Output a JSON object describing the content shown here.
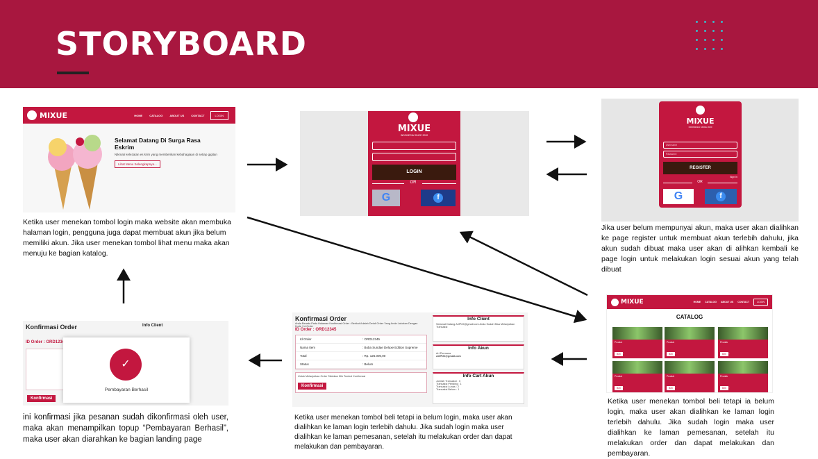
{
  "title": "STORYBOARD",
  "brand": "MIXUE",
  "brand_sub": "INDONESIA SINCE 2020",
  "nav": {
    "home": "HOME",
    "catalog": "CATALOG",
    "about": "ABOUT US",
    "contact": "CONTACT",
    "login": "LOGIN"
  },
  "landing": {
    "heading_1": "Selamat Datang Di Surga Rasa",
    "heading_2": "Eskrim",
    "body": "Nikmati kelezatan es krim yang memberikan kebahagiaan di setiap gigitan",
    "button": "Lihat Menu Selengkapnya...",
    "desc": "Ketika user  menekan tombol login maka website akan membuka halaman login, pengguna juga dapat membuat akun jika belum memiliki akun. Jika user menekan tombol lihat menu maka akan menuju ke bagian katalog."
  },
  "login": {
    "button": "LOGIN",
    "or": "OR",
    "google": "G",
    "facebook": "f"
  },
  "register": {
    "username_placeholder": "Username",
    "password_placeholder": "Password",
    "button": "REGISTER",
    "signin": "Sign In",
    "or": "OR",
    "desc": "Jika user belum mempunyai akun, maka user akan dialihkan ke page register untuk membuat akun terlebih dahulu, jika akun sudah dibuat maka user akan di alihkan kembali ke page login untuk melakukan login sesuai akun yang telah dibuat"
  },
  "catalog": {
    "title": "CATALOG",
    "item_label": "Produk",
    "item_price": "Rp. ........",
    "buy": "Beli",
    "desc": "Ketika user  menekan tombol beli tetapi ia belum login, maka user akan dialihkan ke laman login terlebih dahulu. Jika sudah login maka user dialihkan ke laman pemesanan, setelah itu melakukan order dan dapat melakukan dan pembayaran."
  },
  "order": {
    "title": "Konfirmasi Order",
    "subtitle": "Anda Berada Pada Halaman Konfirmasi Order : Berikut Adalah Detail Order Yang Anda Lakukan Dengan Kode / Id Order",
    "id_line": "ID Order : ORD12345",
    "rows": [
      {
        "k": "Id Order",
        "v": ": ORD12345"
      },
      {
        "k": "Nama Item",
        "v": ": Boba Sundae Deluxe Edition Supreme"
      },
      {
        "k": "Total",
        "v": ": Rp. 125.000,00"
      },
      {
        "k": "Status",
        "v": ": Belum"
      }
    ],
    "note": "Untuk Melanjutkan Order Silahkan Klik Tombol Konfirmasi",
    "confirm": "Konfirmasi",
    "info_client": "Info Client",
    "client_text": "Selamat Datang ArifP22@gmail.com Anda Sudah Bisa Melanjutkan Transaksi",
    "info_akun": "Info Akun",
    "akun_name": "Ari Permana",
    "akun_email": "ArifP22@gmail.com",
    "info_cart": "Info Cart Akun",
    "cart_lines": [
      "Jumlah Transaksi : 3",
      "Transaksi Pending : 1",
      "Transaksi Lunas : 2",
      "Transaksi Belum : 1"
    ],
    "desc": "Ketika user  menekan tombol beli tetapi ia belum login, maka user akan dialihkan ke laman login terlebih dahulu. Jika sudah login maka user dialihkan ke laman pemesanan, setelah itu melakukan order dan dapat melakukan dan pembayaran."
  },
  "success": {
    "title": "Konfirmasi Order",
    "id_line": "ID Order : ORD12345",
    "info_client": "Info Client",
    "popup": "Pembayaran Berhasil",
    "confirm": "Konfirmasi",
    "desc": "ini konfirmasi jika pesanan sudah dikonfirmasi oleh user, maka akan menampilkan topup “Pembayaran Berhasil”, maka user akan diarahkan ke bagian landing page"
  },
  "colors": {
    "header": "#a8173f",
    "brand_pink": "#c3173f",
    "accent_dots": "#3bb9c9"
  }
}
